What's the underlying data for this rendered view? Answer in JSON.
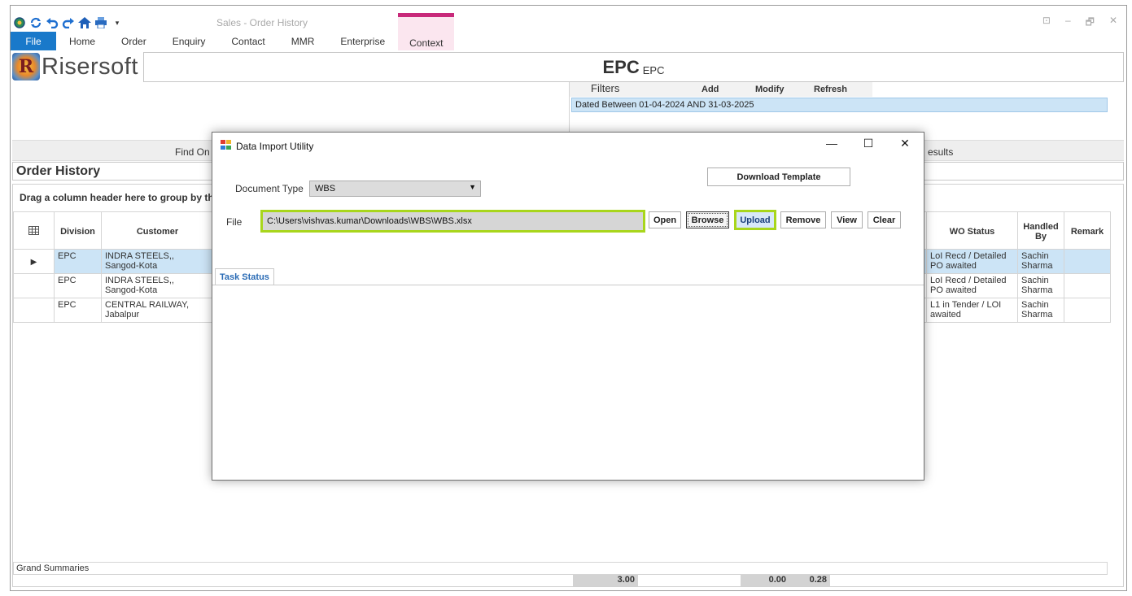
{
  "window": {
    "title": "Sales - Order History",
    "controls": [
      "⊡",
      "–",
      "🗗",
      "✕"
    ]
  },
  "qat_icons": [
    "app-icon",
    "refresh-icon",
    "undo-icon",
    "redo-icon",
    "home-icon",
    "print-icon",
    "dropdown-icon"
  ],
  "ribbon": {
    "tabs": [
      "File",
      "Home",
      "Order",
      "Enquiry",
      "Contact",
      "MMR",
      "Enterprise",
      "Context"
    ],
    "active_context_color": "#c8297a"
  },
  "logo": {
    "text": "Risersoft",
    "mark": "R"
  },
  "header": {
    "title": "EPC",
    "subtitle": "EPC"
  },
  "filters": {
    "title": "Filters",
    "buttons": [
      "Add",
      "Modify",
      "Refresh"
    ],
    "rows": [
      "Dated Between  01-04-2024 AND 31-03-2025"
    ]
  },
  "find_strip": {
    "find_on": "Find On",
    "results": "esults"
  },
  "section_title": "Order History",
  "group_hint": "Drag a column header here to group by th",
  "grid": {
    "columns": [
      "Division",
      "Customer",
      "WO Status",
      "Handled By",
      "Remark"
    ],
    "rows": [
      {
        "division": "EPC",
        "customer": "INDRA STEELS,, Sangod-Kota",
        "wo_status": "LoI Recd / Detailed PO awaited",
        "handled_by": "Sachin Sharma",
        "remark": "",
        "selected": true
      },
      {
        "division": "EPC",
        "customer": "INDRA STEELS,, Sangod-Kota",
        "wo_status": "LoI Recd / Detailed PO awaited",
        "handled_by": "Sachin Sharma",
        "remark": "",
        "selected": false
      },
      {
        "division": "EPC",
        "customer": "CENTRAL RAILWAY, Jabalpur",
        "wo_status": "L1 in Tender / LOI awaited",
        "handled_by": "Sachin Sharma",
        "remark": "",
        "selected": false
      }
    ]
  },
  "summary": {
    "label": "Grand Summaries",
    "totals": [
      "3.00",
      "0.00",
      "0.28"
    ]
  },
  "dialog": {
    "title": "Data Import Utility",
    "controls": [
      "—",
      "☐",
      "✕"
    ],
    "download_template": "Download Template",
    "document_type_label": "Document Type",
    "document_type_value": "WBS",
    "file_label": "File",
    "file_path": "C:\\Users\\vishvas.kumar\\Downloads\\WBS\\WBS.xlsx",
    "buttons": [
      "Open",
      "Browse",
      "Upload",
      "Remove",
      "View",
      "Clear"
    ],
    "tab": "Task Status",
    "highlight_color": "#a8d61c"
  }
}
